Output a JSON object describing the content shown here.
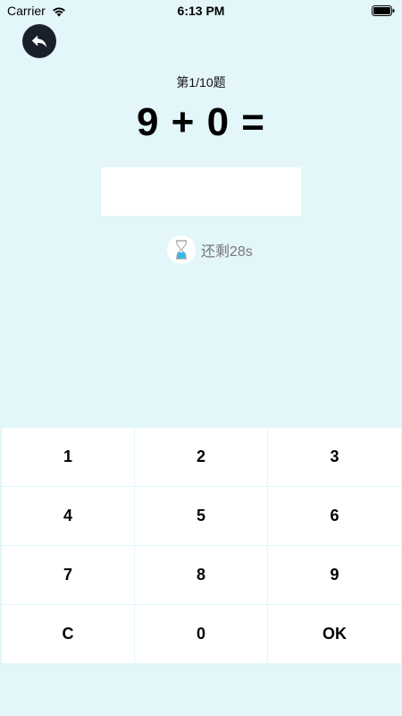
{
  "status_bar": {
    "carrier": "Carrier",
    "time": "6:13 PM",
    "icons": [
      "wifi-icon",
      "battery-icon"
    ]
  },
  "header": {
    "back_icon": "back-arrow-icon"
  },
  "quiz": {
    "progress": "第1/10题",
    "equation": "9 + 0 =",
    "answer_value": "",
    "timer_icon": "hourglass-icon",
    "timer_text": "还剩28s"
  },
  "keypad": {
    "keys": [
      "1",
      "2",
      "3",
      "4",
      "5",
      "6",
      "7",
      "8",
      "9",
      "C",
      "0",
      "OK"
    ]
  },
  "colors": {
    "background": "#e3f6fa",
    "back_button": "#1a1f2c",
    "key_background": "#ffffff",
    "timer_text": "#777777",
    "hourglass_fill": "#3db7e8"
  }
}
